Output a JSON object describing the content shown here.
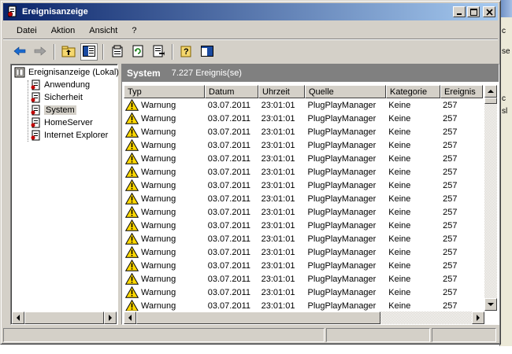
{
  "window": {
    "title": "Ereignisanzeige"
  },
  "menu": [
    {
      "label": "Datei"
    },
    {
      "label": "Aktion"
    },
    {
      "label": "Ansicht"
    },
    {
      "label": "?"
    }
  ],
  "toolbar": [
    "back",
    "forward",
    "up-folder",
    "show-hide-tree",
    "properties",
    "refresh",
    "export-list",
    "help",
    "show-hide-action-pane"
  ],
  "tree": {
    "root": "Ereignisanzeige (Lokal)",
    "items": [
      "Anwendung",
      "Sicherheit",
      "System",
      "HomeServer",
      "Internet Explorer"
    ],
    "selected": "System"
  },
  "list": {
    "name": "System",
    "count": "7.227 Ereignis(se)",
    "columns": [
      "Typ",
      "Datum",
      "Uhrzeit",
      "Quelle",
      "Kategorie",
      "Ereignis"
    ],
    "rows": [
      [
        "Warnung",
        "03.07.2011",
        "23:01:01",
        "PlugPlayManager",
        "Keine",
        "257"
      ],
      [
        "Warnung",
        "03.07.2011",
        "23:01:01",
        "PlugPlayManager",
        "Keine",
        "257"
      ],
      [
        "Warnung",
        "03.07.2011",
        "23:01:01",
        "PlugPlayManager",
        "Keine",
        "257"
      ],
      [
        "Warnung",
        "03.07.2011",
        "23:01:01",
        "PlugPlayManager",
        "Keine",
        "257"
      ],
      [
        "Warnung",
        "03.07.2011",
        "23:01:01",
        "PlugPlayManager",
        "Keine",
        "257"
      ],
      [
        "Warnung",
        "03.07.2011",
        "23:01:01",
        "PlugPlayManager",
        "Keine",
        "257"
      ],
      [
        "Warnung",
        "03.07.2011",
        "23:01:01",
        "PlugPlayManager",
        "Keine",
        "257"
      ],
      [
        "Warnung",
        "03.07.2011",
        "23:01:01",
        "PlugPlayManager",
        "Keine",
        "257"
      ],
      [
        "Warnung",
        "03.07.2011",
        "23:01:01",
        "PlugPlayManager",
        "Keine",
        "257"
      ],
      [
        "Warnung",
        "03.07.2011",
        "23:01:01",
        "PlugPlayManager",
        "Keine",
        "257"
      ],
      [
        "Warnung",
        "03.07.2011",
        "23:01:01",
        "PlugPlayManager",
        "Keine",
        "257"
      ],
      [
        "Warnung",
        "03.07.2011",
        "23:01:01",
        "PlugPlayManager",
        "Keine",
        "257"
      ],
      [
        "Warnung",
        "03.07.2011",
        "23:01:01",
        "PlugPlayManager",
        "Keine",
        "257"
      ],
      [
        "Warnung",
        "03.07.2011",
        "23:01:01",
        "PlugPlayManager",
        "Keine",
        "257"
      ],
      [
        "Warnung",
        "03.07.2011",
        "23:01:01",
        "PlugPlayManager",
        "Keine",
        "257"
      ],
      [
        "Warnung",
        "03.07.2011",
        "23:01:01",
        "PlugPlayManager",
        "Keine",
        "257"
      ]
    ]
  },
  "background_window": {
    "text": [
      "c",
      "se",
      "sl"
    ]
  },
  "colors": {
    "title_start": "#0a246a",
    "title_end": "#a6caf0",
    "face": "#d4d0c8",
    "header_gray": "#808080",
    "warning": "#ffd800"
  }
}
